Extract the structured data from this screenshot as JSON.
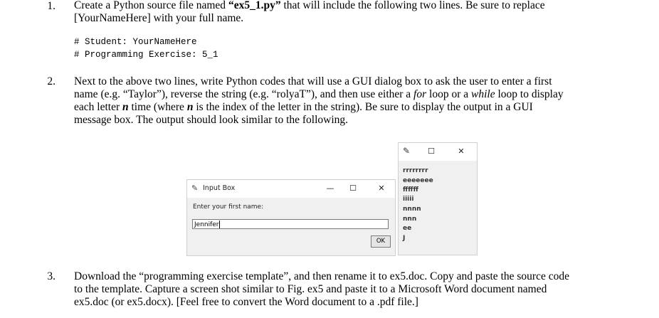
{
  "items": [
    {
      "number": "1.",
      "lines": [
        "Create a Python source file named “ex5_1.py” that will include the following two lines. Be sure to replace",
        "[YourNameHere] with your full name."
      ],
      "code": [
        "# Student: YourNameHere",
        "# Programming Exercise: 5_1"
      ]
    },
    {
      "number": "2.",
      "lines": [
        "Next to the above two lines, write Python codes that will use a GUI dialog box to ask the user to enter a first",
        "name (e.g. “Taylor”), reverse the string (e.g. “rolyaT”), and then use either a for loop or a while loop to display",
        "each letter n time (where n is the index of the letter in the string). Be sure to display the output in a GUI",
        "message box. The output should look similar to the following."
      ]
    },
    {
      "number": "3.",
      "lines": [
        "Download the “programming exercise template”, and then rename it to ex5.doc. Copy and paste the source code",
        "to the template. Capture a screen shot similar to Fig. ex5 and paste it to a Microsoft Word document named",
        "ex5.doc (or ex5.docx). [Feel free to convert the Word document to a .pdf file.]"
      ]
    }
  ],
  "input_dialog": {
    "title": "Input Box",
    "minimize": "—",
    "maximize": "☐",
    "close": "✕",
    "prompt": "Enter your first name:",
    "value": "Jennifer",
    "ok": "OK"
  },
  "message_box": {
    "minimize": "—",
    "maximize": "☐",
    "close": "✕",
    "lines": [
      "rrrrrrrr",
      "eeeeeee",
      "ffffff",
      "iiiii",
      "nnnn",
      "nnn",
      "ee",
      "J"
    ]
  }
}
